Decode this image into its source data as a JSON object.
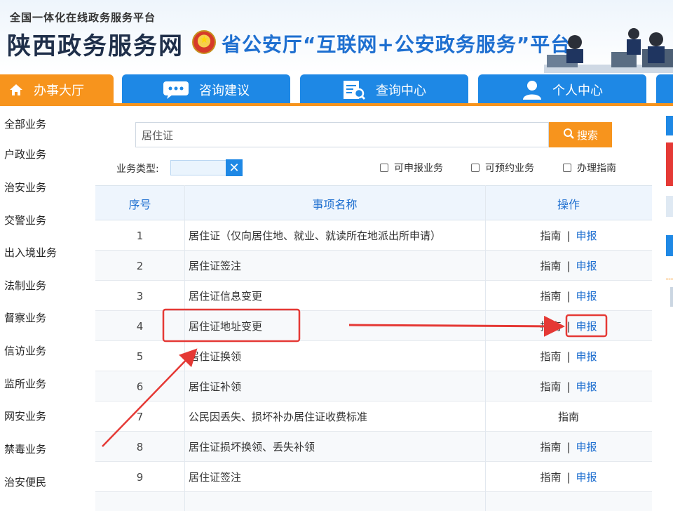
{
  "header": {
    "platform_sub": "全国一体化在线政务服务平台",
    "site_title": "陕西政务服务网",
    "dept_title": "省公安厅“互联网+公安政务服务”平台"
  },
  "nav": {
    "tabs": [
      {
        "label": "办事大厅",
        "icon": "home-icon",
        "active": true
      },
      {
        "label": "咨询建议",
        "icon": "chat-icon",
        "active": false
      },
      {
        "label": "查询中心",
        "icon": "document-search-icon",
        "active": false
      },
      {
        "label": "个人中心",
        "icon": "user-icon",
        "active": false
      }
    ]
  },
  "sidebar": {
    "items": [
      "全部业务",
      "户政业务",
      "治安业务",
      "交警业务",
      "出入境业务",
      "法制业务",
      "督察业务",
      "信访业务",
      "监所业务",
      "网安业务",
      "禁毒业务",
      "治安便民"
    ]
  },
  "search": {
    "value": "居住证",
    "button_label": "搜索"
  },
  "filter": {
    "type_label": "业务类型:",
    "checkboxes": [
      "可申报业务",
      "可预约业务",
      "办理指南"
    ]
  },
  "table": {
    "headers": [
      "序号",
      "事项名称",
      "操作"
    ],
    "rows": [
      {
        "num": "1",
        "name": "居住证（仅向居住地、就业、就读所在地派出所申请）",
        "guide": "指南",
        "apply": "申报"
      },
      {
        "num": "2",
        "name": "居住证签注",
        "guide": "指南",
        "apply": "申报"
      },
      {
        "num": "3",
        "name": "居住证信息变更",
        "guide": "指南",
        "apply": "申报"
      },
      {
        "num": "4",
        "name": "居住证地址变更",
        "guide": "指南",
        "apply": "申报"
      },
      {
        "num": "5",
        "name": "居住证换领",
        "guide": "指南",
        "apply": "申报"
      },
      {
        "num": "6",
        "name": "居住证补领",
        "guide": "指南",
        "apply": "申报"
      },
      {
        "num": "7",
        "name": "公民因丢失、损坏补办居住证收费标准",
        "guide": "指南",
        "apply": ""
      },
      {
        "num": "8",
        "name": "居住证损坏换领、丢失补领",
        "guide": "指南",
        "apply": "申报"
      },
      {
        "num": "9",
        "name": "居住证签注",
        "guide": "指南",
        "apply": "申报"
      }
    ],
    "op_separator": "|"
  },
  "colors": {
    "orange": "#f7941d",
    "blue": "#1e88e5",
    "annotation_red": "#e53935"
  }
}
